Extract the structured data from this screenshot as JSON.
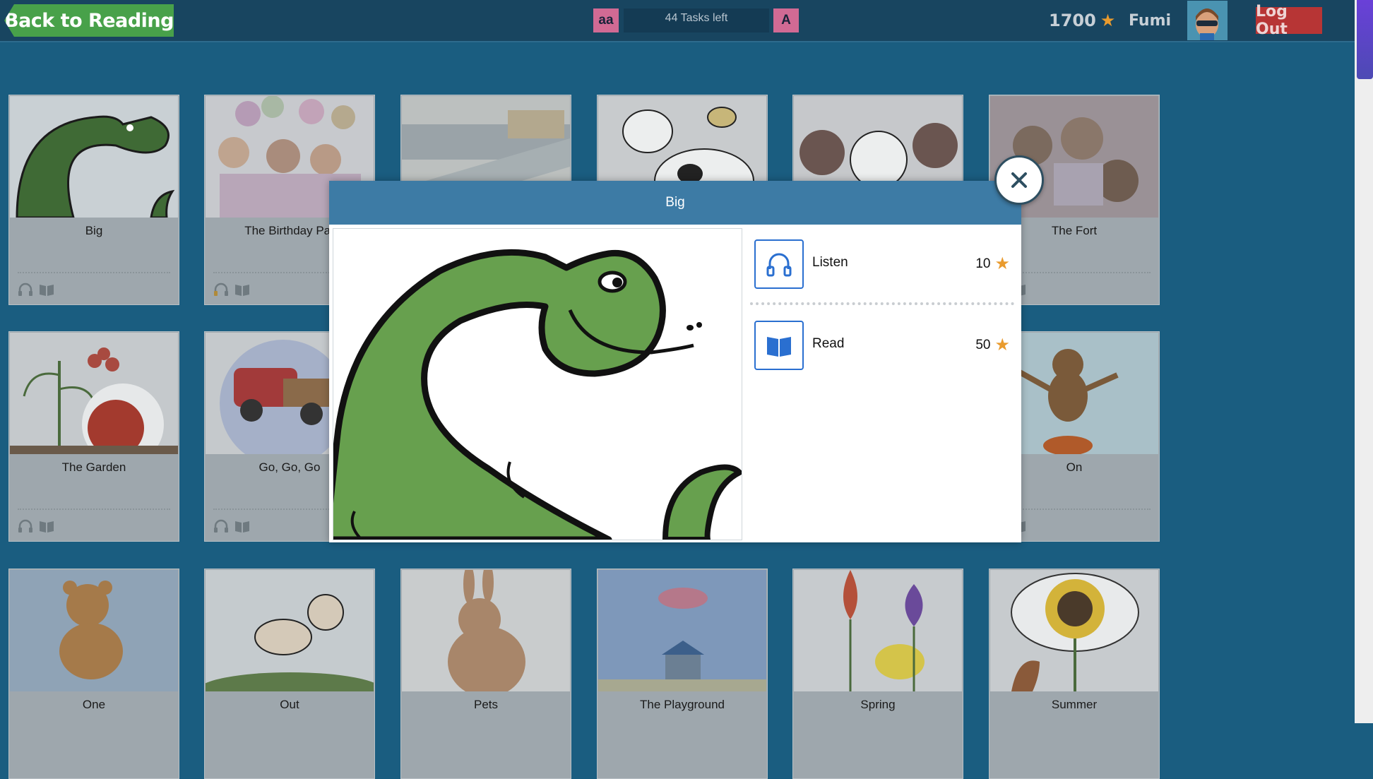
{
  "header": {
    "back_label": "Back to Reading",
    "font_small_label": "aa",
    "font_large_label": "A",
    "tasks_left": "44 Tasks left",
    "points": "1700",
    "username": "Fumi",
    "logout_label": "Log Out"
  },
  "books": [
    {
      "title": "Big"
    },
    {
      "title": "The Birthday Par"
    },
    {
      "title": ""
    },
    {
      "title": ""
    },
    {
      "title": ""
    },
    {
      "title": "The Fort"
    },
    {
      "title": "The Garden"
    },
    {
      "title": "Go, Go, Go"
    },
    {
      "title": "On"
    },
    {
      "title": "One"
    },
    {
      "title": "Out"
    },
    {
      "title": "Pets"
    },
    {
      "title": "The Playground"
    },
    {
      "title": "Spring"
    },
    {
      "title": "Summer"
    }
  ],
  "modal": {
    "title": "Big",
    "activities": [
      {
        "label": "Listen",
        "points": "10",
        "icon": "headphones-icon"
      },
      {
        "label": "Read",
        "points": "50",
        "icon": "book-icon"
      }
    ]
  },
  "colors": {
    "accent": "#3d7ba5",
    "back_button": "#48a14a",
    "logout_button": "#b73535",
    "star": "#e99b2e"
  }
}
